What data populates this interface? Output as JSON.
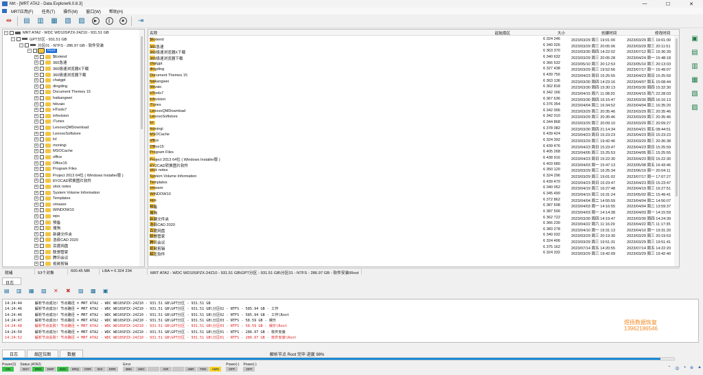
{
  "window": {
    "title": "Mrt - [MRT ATA2 - Data Explorer6.0.8.3]",
    "minimize": "—",
    "maximize": "☐",
    "close": "✕"
  },
  "menu": [
    "MRT应用(F)",
    "任务(T)",
    "操作(M)",
    "窗口(W)",
    "帮助(H)"
  ],
  "tree": {
    "disk": "MRT ATA2 - WDC WD10SPZX-24Z10 - 931.51 GB",
    "gpt": "GPT分区 - 931.51 GB",
    "part": "分区01 - NTFS - 286.97 GB - 软件安装",
    "root": "Root",
    "folders": [
      "$Extend",
      "360急速",
      "360极速浏览器X下载",
      "360极速浏览器下载",
      "chatgpt",
      "dingding",
      "Document Themes 15",
      "haikangwei",
      "hikvaio",
      "HTools7",
      "infovision",
      "iTunes",
      "LenovoQMDownload",
      "LenovoSoftstore",
      "lol",
      "moningi",
      "MSOCache",
      "office",
      "Office15",
      "Program Files",
      "Project 2013 64位 ( Windows Installer版 )",
      "RY2CAD转换图片软件",
      "stick notes",
      "System Volume Information",
      "Templates",
      "vmware",
      "WINDOW10",
      "wps",
      "预备",
      "搜狗",
      "新建文件夹",
      "浩辰CAD 2020",
      "百度网盘",
      "联想管家",
      "腾讯会议",
      "视频剪辑"
    ]
  },
  "filelist": {
    "headers": {
      "name": "名称",
      "sector": "起始扇区",
      "size": "大小",
      "created": "创建时间",
      "modified": "修改时间"
    },
    "rows": [
      [
        "$Extend",
        "6 324 246",
        "2023/03/29 周三 19:01:00",
        "2023/03/29 周三 19:01:00"
      ],
      [
        "360急速",
        "6 340 026",
        "2023/03/29 周三 20:05:06",
        "2023/03/29 周三 20:11:51"
      ],
      [
        "360极速浏览器X下载",
        "6 363 370",
        "2023/03/30 周四 14:22:02",
        "2023/07/12 周三 15:36:39"
      ],
      [
        "360极速浏览器下载",
        "6 340 632",
        "2023/03/29 周三 20:05:28",
        "2023/04/24 周一 15:48:18"
      ],
      [
        "chatgpt",
        "6 366 532",
        "2023/05/10 周三 20:12:53",
        "2023/05/10 周三 20:13:03"
      ],
      [
        "dingding",
        "6 327 438",
        "2023/03/29 周三 19:52:56",
        "2023/07/17 周一 15:49:07"
      ],
      [
        "Document Themes 15",
        "6 439 756",
        "2023/04/23 周日 15:25:55",
        "2023/04/23 周日 15:25:59"
      ],
      [
        "haikangwei",
        "6 363 136",
        "2023/03/30 周四 14:23:16",
        "2023/04/07 周五 15:08:44"
      ],
      [
        "hikvaio",
        "6 362 818",
        "2023/03/30 周四 15:30:13",
        "2023/03/30 周四 15:32:30"
      ],
      [
        "HTools7",
        "6 342 166",
        "2023/04/15 周六 11:08:20",
        "2023/04/15 周六 22:28:03"
      ],
      [
        "infovision",
        "6 367 636",
        "2023/03/30 周四 16:15:47",
        "2023/03/30 周四 16:16:13"
      ],
      [
        "iTunes",
        "6 376 354",
        "2023/04/04 周二 16:34:52",
        "2023/04/04 周二 16:35:20"
      ],
      [
        "LenovoQMDownload",
        "6 342 006",
        "2023/03/29 周三 20:35:46",
        "2023/03/29 周三 20:35:46"
      ],
      [
        "LenovoSoftstore",
        "6 342 010",
        "2023/03/29 周三 20:35:46",
        "2023/03/29 周三 20:35:46"
      ],
      [
        "lol",
        "6 344 868",
        "2023/03/29 周三 20:09:10",
        "2023/03/29 周三 20:09:27"
      ],
      [
        "moningi",
        "6 378 082",
        "2023/03/30 周四 21:14:34",
        "2023/04/21 周五 08:44:51"
      ],
      [
        "MSOCache",
        "6 439 424",
        "2023/04/23 周日 15:23:23",
        "2023/04/23 周日 15:23:23"
      ],
      [
        "office",
        "6 324 392",
        "2023/03/29 周三 19:42:46",
        "2023/03/29 周三 20:36:38"
      ],
      [
        "Office15",
        "6 439 476",
        "2023/04/23 周日 15:23:47",
        "2023/04/23 周日 15:25:59"
      ],
      [
        "Program Files",
        "6 405 268",
        "2023/04/05 周三 15:25:53",
        "2023/04/05 周三 15:25:55"
      ],
      [
        "Project 2013 64位 ( Windows Installer版 )",
        "6 438 916",
        "2023/04/23 周日 15:22:30",
        "2023/04/23 周日 15:22:30"
      ],
      [
        "RY2CAD转换图片软件",
        "6 403 680",
        "2023/04/03 周一 15:47:13",
        "2023/05/08 周五 16:43:46"
      ],
      [
        "stick notes",
        "6 350 120",
        "2023/03/29 周三 16:25:34",
        "2023/06/19 周一 20:04:11"
      ],
      [
        "System Volume Information",
        "6 324 296",
        "2023/03/29 周三 19:01:02",
        "2023/07/17 周一 17:07:27"
      ],
      [
        "Templates",
        "6 439 470",
        "2023/04/23 周日 15:23:47",
        "2023/04/23 周日 15:23:47"
      ],
      [
        "vmware",
        "6 340 052",
        "2023/04/19 周三 16:27:48",
        "2023/04/19 周三 16:27:51"
      ],
      [
        "WINDOW10",
        "6 345 490",
        "2023/04/19 周三 16:31:24",
        "2023/05/02 周二 15:49:41"
      ],
      [
        "wps",
        "6 372 862",
        "2023/04/04 周二 14:55:59",
        "2023/04/04 周二 14:56:07"
      ],
      [
        "预备",
        "6 387 508",
        "2023/04/03 周一 14:16:55",
        "2023/04/04 周二 13:59:37"
      ],
      [
        "搜狗",
        "6 387 506",
        "2023/04/03 周一 14:14:38",
        "2023/04/03 周一 14:15:59"
      ],
      [
        "新建文件夹",
        "6 362 722",
        "2023/03/30 周四 14:19:47",
        "2023/03/30 周四 14:24:39"
      ],
      [
        "浩辰CAD 2020",
        "6 366 230",
        "2023/04/22 周六 11:16:29",
        "2023/04/22 周六 11:17:35"
      ],
      [
        "百度网盘",
        "6 383 278",
        "2023/04/10 周一 19:31:13",
        "2023/04/10 周一 19:31:20"
      ],
      [
        "联想管家",
        "6 340 032",
        "2023/03/29 周三 20:19:30",
        "2023/03/29 周三 20:19:53"
      ],
      [
        "腾讯会议",
        "6 324 406",
        "2023/03/29 周三 19:51:31",
        "2023/03/29 周三 19:51:41"
      ],
      [
        "视频剪辑",
        "6 375 162",
        "2023/07/14 周五 14:20:55",
        "2023/07/14 周五 14:22:20"
      ],
      [
        "解压软件",
        "6 324 332",
        "2023/03/29 周三 19:42:09",
        "2023/03/29 周三 19:42:40"
      ]
    ]
  },
  "status": {
    "ready": "就绪",
    "objects": "53个对象",
    "size": "600.45 MB",
    "lba": "LBA = 6 324 234",
    "path": "MRT ATA2 - WDC WD10SPZX-24Z10 - 931.51 GB\\GPT分区 - 931.51 GB\\分区01 - NTFS - 286.97 GB - 软件安装\\Root"
  },
  "log": {
    "tab": "日志",
    "lines": [
      {
        "time": "14:24:44",
        "text": "解析节点成功!  节点路径 = MRT ATA2 - WDC WD10SPZX-24Z10 - 931.51 GB\\GPT分区 - 931.51 GB",
        "err": false
      },
      {
        "time": "14:24:46",
        "text": "解析节点成功!  节点路径 = MRT ATA2 - WDC WD10SPZX-24Z10 - 931.51 GB\\GPT分区 - 931.51 GB\\分区02 - NTFS - 585.94 GB - 工作",
        "err": false
      },
      {
        "time": "14:24:46",
        "text": "解析节点成功!  节点路径 = MRT ATA2 - WDC WD10SPZX-24Z10 - 931.51 GB\\GPT分区 - 931.51 GB\\分区02 - NTFS - 585.94 GB - 工作\\Root",
        "err": false
      },
      {
        "time": "14:24:47",
        "text": "解析节点成功!  节点路径 = MRT ATA2 - WDC WD10SPZX-24Z10 - 931.51 GB\\GPT分区 - 931.51 GB\\分区03 - NTFS - 58.59 GB - 娱乐",
        "err": false
      },
      {
        "time": "14:24:48",
        "text": "解析节点失败!   节点路径 = MRT ATA2 - WDC WD10SPZX-24Z10 - 931.51 GB\\GPT分区 - 931.51 GB\\分区03 - NTFS - 58.59 GB - 娱乐\\Root",
        "err": true
      },
      {
        "time": "14:24:50",
        "text": "解析节点成功!  节点路径 = MRT ATA2 - WDC WD10SPZX-24Z10 - 931.51 GB\\GPT分区 - 931.51 GB\\分区01 - NTFS - 286.97 GB - 软件安装",
        "err": false
      },
      {
        "time": "14:24:52",
        "text": "解析节点失败!   节点路径 = MRT ATA2 - WDC WD10SPZX-24Z10 - 931.51 GB\\GPT分区 - 931.51 GB\\分区01 - NTFS - 286.97 GB - 软件安装\\Root",
        "err": true
      }
    ],
    "watermark1": "煜扬数据恢复",
    "watermark2": "13962186546"
  },
  "bottom_tabs": [
    "日志",
    "扇区位图",
    "数据"
  ],
  "progress": {
    "text": "解析节点 Root 完毕  进度 98%",
    "percent": 98
  },
  "indicators": {
    "power2": {
      "label": "Power(2)",
      "lights": [
        "ON"
      ]
    },
    "status": {
      "label": "Status (ATA2)",
      "lights": [
        "BSY",
        "DRD",
        "DWF",
        "DSC",
        "DRQ",
        "CRR",
        "IDX",
        "ERR"
      ]
    },
    "error": {
      "label": "Error",
      "lights": [
        "BBK",
        "UNC",
        "",
        "INF",
        "",
        "ABR",
        "TON",
        "AMN"
      ]
    },
    "powerA": {
      "label": "Power(-)",
      "lights": [
        "OFF"
      ]
    },
    "powerB": {
      "label": "Power(-)",
      "lights": [
        "OFF"
      ]
    }
  },
  "tray": [
    "⌃",
    "中",
    "◑",
    "⊕",
    "▲"
  ]
}
